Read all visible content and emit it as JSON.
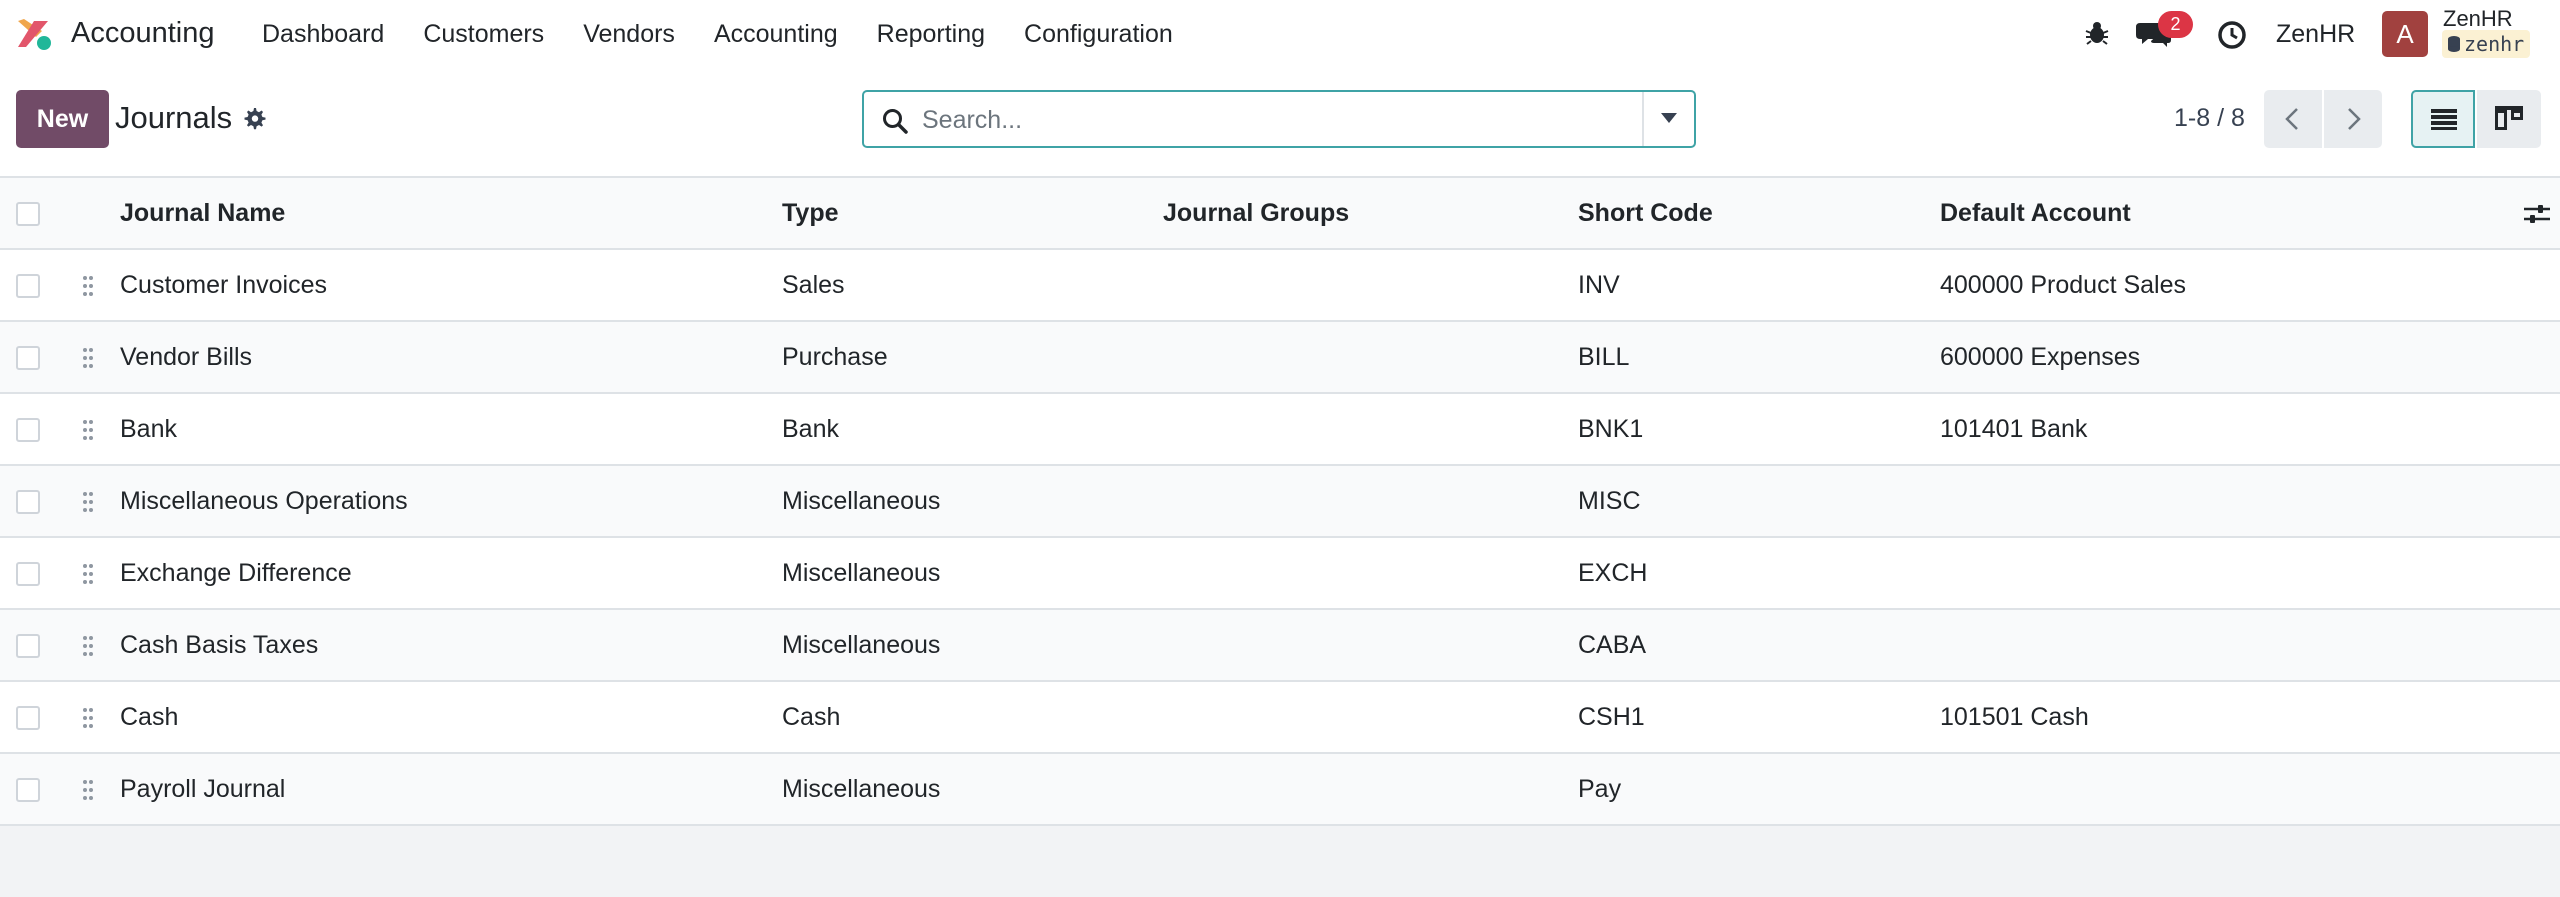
{
  "app": {
    "name": "Accounting"
  },
  "nav": {
    "items": [
      "Dashboard",
      "Customers",
      "Vendors",
      "Accounting",
      "Reporting",
      "Configuration"
    ]
  },
  "systray": {
    "chat_count": "2",
    "company": "ZenHR",
    "avatar_letter": "A",
    "user_name": "ZenHR",
    "database": "zenhr"
  },
  "control_panel": {
    "new_label": "New",
    "title": "Journals",
    "search_placeholder": "Search...",
    "pager_value": "1-8 / 8"
  },
  "table": {
    "columns": [
      "Journal Name",
      "Type",
      "Journal Groups",
      "Short Code",
      "Default Account"
    ],
    "rows": [
      {
        "name": "Customer Invoices",
        "type": "Sales",
        "groups": "",
        "code": "INV",
        "account": "400000 Product Sales"
      },
      {
        "name": "Vendor Bills",
        "type": "Purchase",
        "groups": "",
        "code": "BILL",
        "account": "600000 Expenses"
      },
      {
        "name": "Bank",
        "type": "Bank",
        "groups": "",
        "code": "BNK1",
        "account": "101401 Bank"
      },
      {
        "name": "Miscellaneous Operations",
        "type": "Miscellaneous",
        "groups": "",
        "code": "MISC",
        "account": ""
      },
      {
        "name": "Exchange Difference",
        "type": "Miscellaneous",
        "groups": "",
        "code": "EXCH",
        "account": ""
      },
      {
        "name": "Cash Basis Taxes",
        "type": "Miscellaneous",
        "groups": "",
        "code": "CABA",
        "account": ""
      },
      {
        "name": "Cash",
        "type": "Cash",
        "groups": "",
        "code": "CSH1",
        "account": "101501 Cash"
      },
      {
        "name": "Payroll Journal",
        "type": "Miscellaneous",
        "groups": "",
        "code": "Pay",
        "account": ""
      }
    ]
  }
}
